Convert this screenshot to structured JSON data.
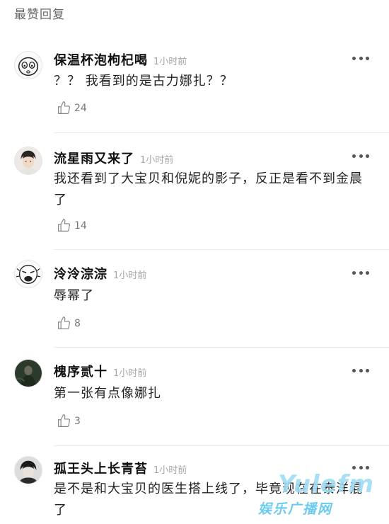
{
  "section_title": "最赞回复",
  "comments": [
    {
      "username": "保温杯泡枸杞喝",
      "time": "1小时前",
      "text": "？？ 我看到的是古力娜扎？？",
      "likes": "24",
      "avatar_icon": "cartoon-face-avatar"
    },
    {
      "username": "流星雨又来了",
      "time": "1小时前",
      "text": "我还看到了大宝贝和倪妮的影子，反正是看不到金晨了",
      "likes": "14",
      "avatar_icon": "man-portrait-avatar"
    },
    {
      "username": "泠泠淙淙",
      "time": "1小时前",
      "text": "辱幂了",
      "likes": "8",
      "avatar_icon": "meme-face-avatar"
    },
    {
      "username": "槐序贰十",
      "time": "1小时前",
      "text": "第一张有点像娜扎",
      "likes": "3",
      "avatar_icon": "dark-portrait-avatar"
    },
    {
      "username": "孤王头上长青苔",
      "time": "1小时前",
      "text": "是不是和大宝贝的医生搭上线了，毕竟现在在泰洋混了",
      "avatar_icon": "man-portrait-avatar"
    }
  ],
  "watermark": {
    "logo": "Yulefm",
    "subtitle": "娱乐广播网",
    "color": "#5cc6ee"
  }
}
